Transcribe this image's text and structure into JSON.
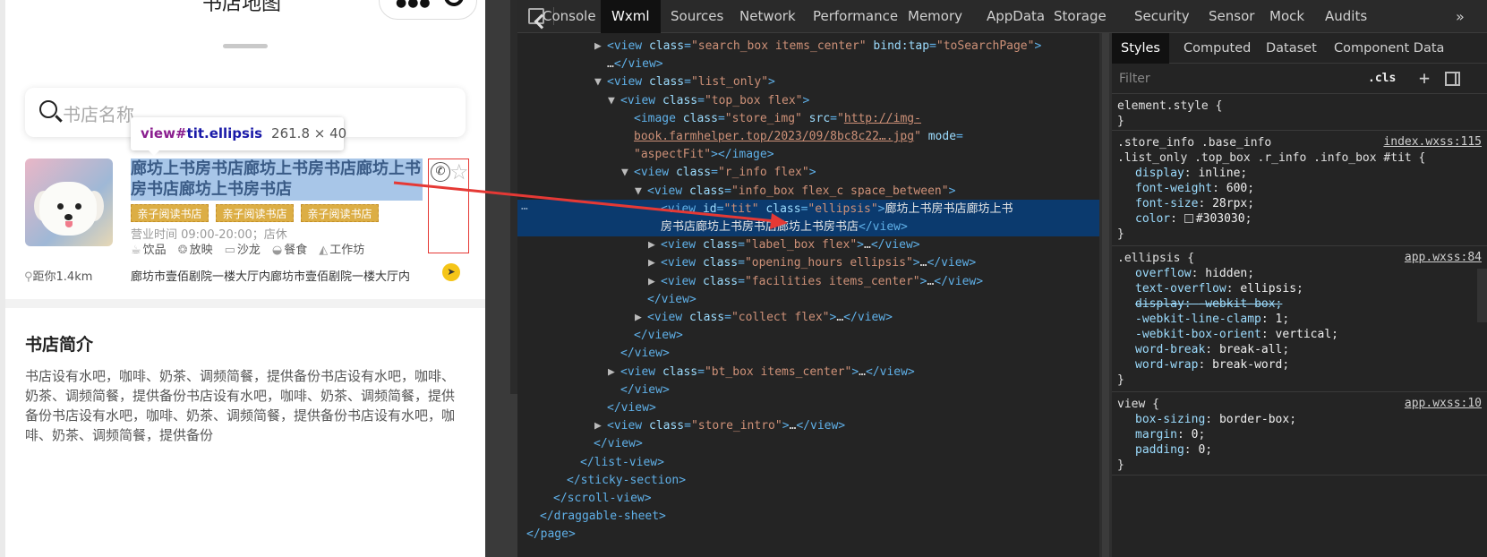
{
  "phone": {
    "title": "书店地图",
    "search_placeholder": "书店名称",
    "tooltip": {
      "prefix": "view#",
      "selector": "tit.ellipsis",
      "size": "261.8 × 40"
    },
    "store": {
      "name": "廊坊上书房书店廊坊上书房书店廊坊上书房书店廊坊上书房书店",
      "labels": [
        "亲子阅读书店",
        "亲子阅读书店",
        "亲子阅读书店"
      ],
      "hours": "营业时间 09:00-20:00；店休",
      "facilities": [
        {
          "icon": "drink-icon",
          "label": "饮品"
        },
        {
          "icon": "projection-icon",
          "label": "放映"
        },
        {
          "icon": "sofa-icon",
          "label": "沙龙"
        },
        {
          "icon": "meal-icon",
          "label": "餐食"
        },
        {
          "icon": "workspace-icon",
          "label": "工作坊"
        }
      ],
      "distance": "距你1.4km",
      "address": "廊坊市壹佰剧院一楼大厅内廊坊市壹佰剧院一楼大厅内"
    },
    "intro": {
      "title": "书店简介",
      "body": "书店设有水吧，咖啡、奶茶、调频简餐，提供备份书店设有水吧，咖啡、奶茶、调频简餐，提供备份书店设有水吧，咖啡、奶茶、调频简餐，提供备份书店设有水吧，咖啡、奶茶、调频简餐，提供备份书店设有水吧，咖啡、奶茶、调频简餐，提供备份"
    }
  },
  "devtools": {
    "tabs": [
      "Console",
      "Wxml",
      "Sources",
      "Network",
      "Performance",
      "Memory",
      "AppData",
      "Storage",
      "Security",
      "Sensor",
      "Mock",
      "Audits"
    ],
    "active_tab": "Wxml",
    "tree": [
      {
        "indent": 0,
        "tw": "▶",
        "parts": [
          [
            "tag",
            "<view "
          ],
          [
            "attr",
            "class"
          ],
          [
            "tag",
            "="
          ],
          [
            "val",
            "\"search_box items_center\""
          ],
          [
            "attr",
            " bind:tap"
          ],
          [
            "tag",
            "="
          ],
          [
            "val",
            "\"toSearchPage\""
          ],
          [
            "tag",
            ">"
          ]
        ]
      },
      {
        "indent": 0,
        "tw": "",
        "parts": [
          [
            "txt",
            "…"
          ],
          [
            "tag",
            "</view>"
          ]
        ]
      },
      {
        "indent": 0,
        "tw": "▼",
        "parts": [
          [
            "tag",
            "<view "
          ],
          [
            "attr",
            "class"
          ],
          [
            "tag",
            "="
          ],
          [
            "val",
            "\"list_only\""
          ],
          [
            "tag",
            ">"
          ]
        ]
      },
      {
        "indent": 1,
        "tw": "▼",
        "parts": [
          [
            "tag",
            "<view "
          ],
          [
            "attr",
            "class"
          ],
          [
            "tag",
            "="
          ],
          [
            "val",
            "\"top_box flex\""
          ],
          [
            "tag",
            ">"
          ]
        ]
      },
      {
        "indent": 2,
        "tw": "",
        "parts": [
          [
            "tag",
            "<image "
          ],
          [
            "attr",
            "class"
          ],
          [
            "tag",
            "="
          ],
          [
            "val",
            "\"store_img\""
          ],
          [
            "attr",
            " src"
          ],
          [
            "tag",
            "="
          ],
          [
            "val",
            "\""
          ],
          [
            "link",
            "http://img-"
          ]
        ]
      },
      {
        "indent": 2,
        "tw": "",
        "parts": [
          [
            "link",
            "book.farmhelper.top/2023/09/8bc8c22….jpg"
          ],
          [
            "val",
            "\""
          ],
          [
            "attr",
            " mode"
          ],
          [
            "tag",
            "="
          ]
        ]
      },
      {
        "indent": 2,
        "tw": "",
        "parts": [
          [
            "val",
            "\"aspectFit\""
          ],
          [
            "tag",
            "></image>"
          ]
        ]
      },
      {
        "indent": 2,
        "tw": "▼",
        "parts": [
          [
            "tag",
            "<view "
          ],
          [
            "attr",
            "class"
          ],
          [
            "tag",
            "="
          ],
          [
            "val",
            "\"r_info flex\""
          ],
          [
            "tag",
            ">"
          ]
        ]
      },
      {
        "indent": 3,
        "tw": "▼",
        "parts": [
          [
            "tag",
            "<view "
          ],
          [
            "attr",
            "class"
          ],
          [
            "tag",
            "="
          ],
          [
            "val",
            "\"info_box flex_c space_between\""
          ],
          [
            "tag",
            ">"
          ]
        ]
      },
      {
        "indent": 4,
        "tw": "",
        "sel": true,
        "parts": [
          [
            "tag",
            "<view "
          ],
          [
            "attr",
            "id"
          ],
          [
            "tag",
            "="
          ],
          [
            "val",
            "\"tit\""
          ],
          [
            "attr",
            " class"
          ],
          [
            "tag",
            "="
          ],
          [
            "val",
            "\"ellipsis\""
          ],
          [
            "tag",
            ">"
          ],
          [
            "txt",
            "廊坊上书房书店廊坊上书"
          ]
        ]
      },
      {
        "indent": 4,
        "tw": "",
        "sel": true,
        "parts": [
          [
            "txt",
            "房书店廊坊上书房书店廊坊上书房书店"
          ],
          [
            "tag",
            "</view>"
          ]
        ]
      },
      {
        "indent": 4,
        "tw": "▶",
        "parts": [
          [
            "tag",
            "<view "
          ],
          [
            "attr",
            "class"
          ],
          [
            "tag",
            "="
          ],
          [
            "val",
            "\"label_box flex\""
          ],
          [
            "tag",
            ">"
          ],
          [
            "txt",
            "…"
          ],
          [
            "tag",
            "</view>"
          ]
        ]
      },
      {
        "indent": 4,
        "tw": "▶",
        "parts": [
          [
            "tag",
            "<view "
          ],
          [
            "attr",
            "class"
          ],
          [
            "tag",
            "="
          ],
          [
            "val",
            "\"opening_hours ellipsis\""
          ],
          [
            "tag",
            ">"
          ],
          [
            "txt",
            "…"
          ],
          [
            "tag",
            "</view>"
          ]
        ]
      },
      {
        "indent": 4,
        "tw": "▶",
        "parts": [
          [
            "tag",
            "<view "
          ],
          [
            "attr",
            "class"
          ],
          [
            "tag",
            "="
          ],
          [
            "val",
            "\"facilities items_center\""
          ],
          [
            "tag",
            ">"
          ],
          [
            "txt",
            "…"
          ],
          [
            "tag",
            "</view>"
          ]
        ]
      },
      {
        "indent": 3,
        "tw": "",
        "parts": [
          [
            "tag",
            "</view>"
          ]
        ]
      },
      {
        "indent": 3,
        "tw": "▶",
        "parts": [
          [
            "tag",
            "<view "
          ],
          [
            "attr",
            "class"
          ],
          [
            "tag",
            "="
          ],
          [
            "val",
            "\"collect flex\""
          ],
          [
            "tag",
            ">"
          ],
          [
            "txt",
            "…"
          ],
          [
            "tag",
            "</view>"
          ]
        ]
      },
      {
        "indent": 2,
        "tw": "",
        "parts": [
          [
            "tag",
            "</view>"
          ]
        ]
      },
      {
        "indent": 1,
        "tw": "",
        "parts": [
          [
            "tag",
            "</view>"
          ]
        ]
      },
      {
        "indent": 1,
        "tw": "▶",
        "parts": [
          [
            "tag",
            "<view "
          ],
          [
            "attr",
            "class"
          ],
          [
            "tag",
            "="
          ],
          [
            "val",
            "\"bt_box items_center\""
          ],
          [
            "tag",
            ">"
          ],
          [
            "txt",
            "…"
          ],
          [
            "tag",
            "</view>"
          ]
        ]
      },
      {
        "indent": 1,
        "tw": "",
        "parts": [
          [
            "tag",
            "</view>"
          ]
        ]
      },
      {
        "indent": 0,
        "tw": "",
        "parts": [
          [
            "tag",
            "</view>"
          ]
        ]
      },
      {
        "indent": 0,
        "tw": "▶",
        "parts": [
          [
            "tag",
            "<view "
          ],
          [
            "attr",
            "class"
          ],
          [
            "tag",
            "="
          ],
          [
            "val",
            "\"store_intro\""
          ],
          [
            "tag",
            ">"
          ],
          [
            "txt",
            "…"
          ],
          [
            "tag",
            "</view>"
          ]
        ]
      },
      {
        "indent": -1,
        "tw": "",
        "parts": [
          [
            "tag",
            "</view>"
          ]
        ]
      },
      {
        "indent": -2,
        "tw": "",
        "parts": [
          [
            "tag",
            "</list-view>"
          ]
        ]
      },
      {
        "indent": -3,
        "tw": "",
        "parts": [
          [
            "tag",
            "</sticky-section>"
          ]
        ]
      },
      {
        "indent": -4,
        "tw": "",
        "parts": [
          [
            "tag",
            "</scroll-view>"
          ]
        ]
      },
      {
        "indent": -5,
        "tw": "",
        "parts": [
          [
            "tag",
            "</draggable-sheet>"
          ]
        ]
      },
      {
        "indent": -6,
        "tw": "",
        "parts": [
          [
            "tag",
            "</page>"
          ]
        ]
      }
    ],
    "styles": {
      "tabs": [
        "Styles",
        "Computed",
        "Dataset",
        "Component Data"
      ],
      "active_tab": "Styles",
      "filter_placeholder": "Filter",
      "cls_label": ".cls",
      "rules": [
        {
          "selectors": [
            "element.style {"
          ],
          "source": "",
          "decls": [],
          "close": "}"
        },
        {
          "selectors": [
            ".store_info .base_info",
            ".list_only .top_box .r_info .info_box #tit {"
          ],
          "source": "index.wxss:115",
          "decls": [
            [
              "display",
              "inline",
              false,
              false
            ],
            [
              "font-weight",
              "600",
              false,
              false
            ],
            [
              "font-size",
              "28rpx",
              false,
              false
            ],
            [
              "color",
              "#303030",
              false,
              true
            ]
          ],
          "close": "}"
        },
        {
          "selectors": [
            ".ellipsis {"
          ],
          "source": "app.wxss:84",
          "decls": [
            [
              "overflow",
              "hidden",
              false,
              false
            ],
            [
              "text-overflow",
              "ellipsis",
              false,
              false
            ],
            [
              "display",
              "-webkit-box",
              true,
              false
            ],
            [
              "-webkit-line-clamp",
              "1",
              false,
              false
            ],
            [
              "-webkit-box-orient",
              "vertical",
              false,
              false
            ],
            [
              "word-break",
              "break-all",
              false,
              false
            ],
            [
              "word-wrap",
              "break-word",
              false,
              false
            ]
          ],
          "close": "}"
        },
        {
          "selectors": [
            "view {"
          ],
          "source": "app.wxss:10",
          "decls": [
            [
              "box-sizing",
              "border-box",
              false,
              false
            ],
            [
              "margin",
              "0",
              false,
              false
            ],
            [
              "padding",
              "0",
              false,
              false
            ]
          ],
          "close": "}"
        }
      ]
    }
  }
}
